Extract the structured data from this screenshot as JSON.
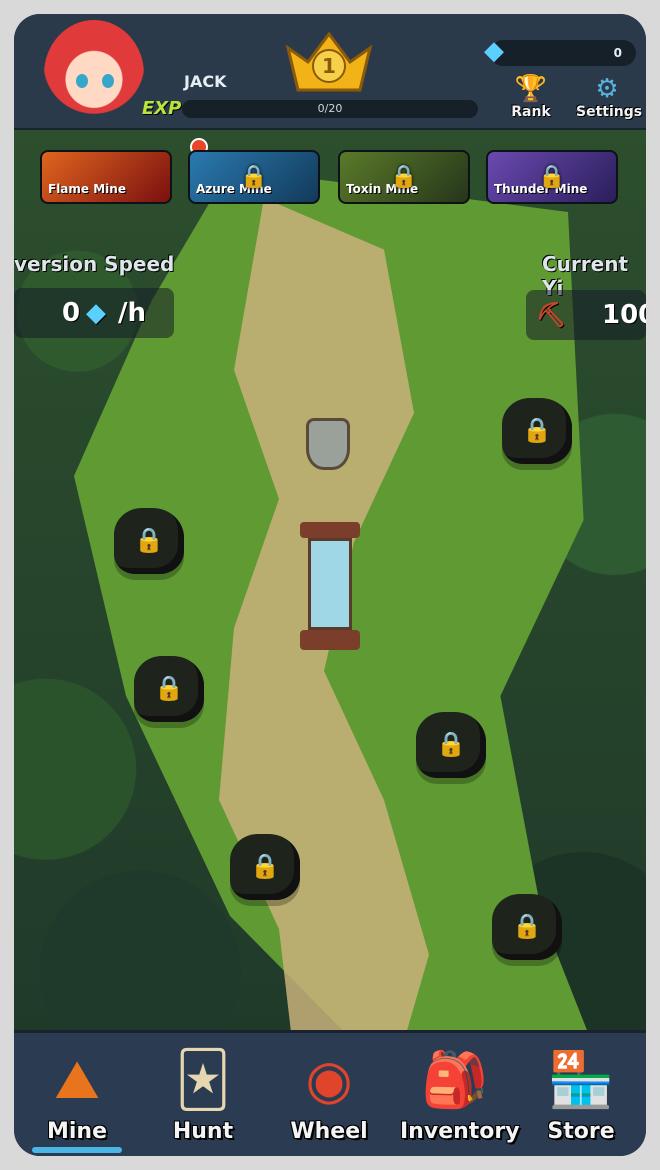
{
  "player": {
    "name": "JACK",
    "exp_label": "EXP",
    "exp_progress": "0/20",
    "level": "1"
  },
  "currency": {
    "gems": "0",
    "gem_icon": "gem-icon"
  },
  "header_buttons": [
    {
      "label": "Rank",
      "icon": "trophy-icon"
    },
    {
      "label": "Settings",
      "icon": "gear-icon"
    }
  ],
  "mines": [
    {
      "label": "Flame Mine",
      "locked": false,
      "color": "#c23a1a"
    },
    {
      "label": "Azure Mine",
      "locked": true,
      "color": "#1f5f8a"
    },
    {
      "label": "Toxin Mine",
      "locked": true,
      "color": "#4a6a2a"
    },
    {
      "label": "Thunder Mine",
      "locked": true,
      "color": "#4a3a8a"
    }
  ],
  "stats": {
    "conversion_label": "version Speed",
    "conversion_value": "0",
    "conversion_unit": "/h",
    "yield_label": "Current Yi",
    "yield_value": "100"
  },
  "nav": [
    {
      "label": "Mine",
      "active": true
    },
    {
      "label": "Hunt",
      "active": false
    },
    {
      "label": "Wheel",
      "active": false
    },
    {
      "label": "Inventory",
      "active": false
    },
    {
      "label": "Store",
      "active": false
    }
  ]
}
